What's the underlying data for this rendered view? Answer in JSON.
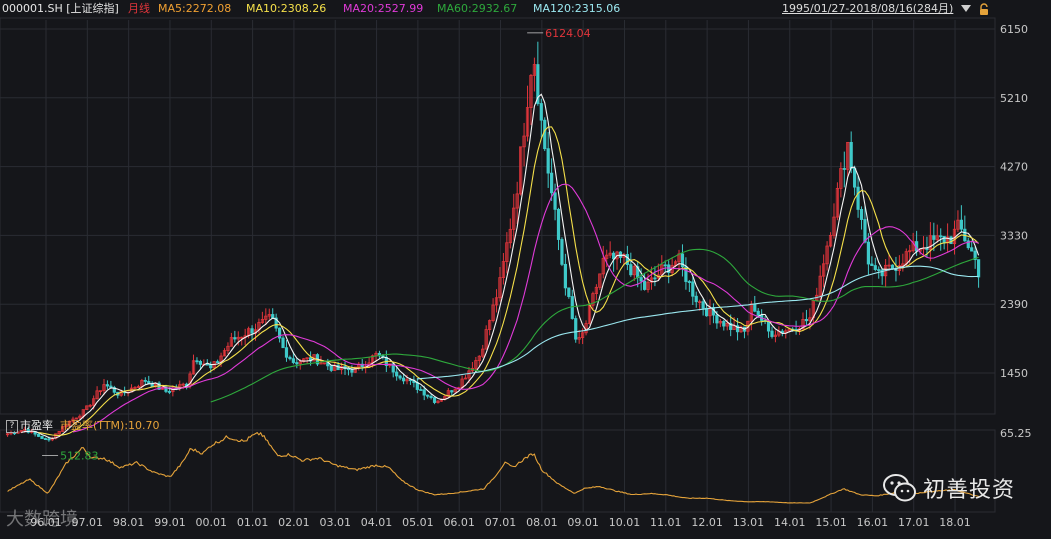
{
  "header": {
    "symbol": "000001.SH [上证综指]",
    "period": "月线",
    "ma5": "MA5:2272.08",
    "ma10": "MA10:2308.26",
    "ma20": "MA20:2527.99",
    "ma60": "MA60:2932.67",
    "ma120": "MA120:2315.06",
    "range": "1995/01/27-2018/08/16(284月)",
    "dropdown_icon": "triangle-down-icon",
    "lock_icon": "lock-icon"
  },
  "subpanel": {
    "help": "?",
    "name": "市盈率",
    "value_label": "市盈率(TTM):10.70"
  },
  "watermark": {
    "brand": "初善投资",
    "wechat_icon": "wechat-icon",
    "source": "大数跨境"
  },
  "colors": {
    "bg": "#15161a",
    "grid": "#2a2c33",
    "up": "#e0353b",
    "down": "#3fc9c9",
    "ma5": "#f5f5f5",
    "ma10": "#f5e04a",
    "ma20": "#e03ad8",
    "ma60": "#2ea83c",
    "ma120": "#9be8f0",
    "pe": "#e5a33a",
    "axis_text": "#c8c8c8"
  },
  "chart_data": [
    {
      "type": "candlestick",
      "title": "000001.SH [上证综指] 月线",
      "y_ticks": [
        1450,
        2390,
        3330,
        4270,
        5210,
        6150
      ],
      "x_ticks": [
        "96.01",
        "97.01",
        "98.01",
        "99.01",
        "00.01",
        "01.01",
        "02.01",
        "03.01",
        "04.01",
        "05.01",
        "06.01",
        "07.01",
        "08.01",
        "09.01",
        "10.01",
        "11.01",
        "12.01",
        "13.01",
        "14.01",
        "15.01",
        "16.01",
        "17.01",
        "18.01"
      ],
      "annotations": [
        {
          "label": "6124.04",
          "date": 2007.79,
          "value": 6124.04
        },
        {
          "label": "512.83",
          "date": 1996.05,
          "value": 512.83
        }
      ],
      "price_anchors": [
        [
          1995.07,
          620
        ],
        [
          1995.5,
          680
        ],
        [
          1996.05,
          520
        ],
        [
          1996.5,
          760
        ],
        [
          1996.95,
          940
        ],
        [
          1997.4,
          1300
        ],
        [
          1997.8,
          1150
        ],
        [
          1998.4,
          1350
        ],
        [
          1998.9,
          1200
        ],
        [
          1999.4,
          1300
        ],
        [
          1999.6,
          1680
        ],
        [
          2000.0,
          1500
        ],
        [
          2000.5,
          1900
        ],
        [
          2001.0,
          2050
        ],
        [
          2001.45,
          2200
        ],
        [
          2001.75,
          1770
        ],
        [
          2002.0,
          1600
        ],
        [
          2002.5,
          1650
        ],
        [
          2003.0,
          1500
        ],
        [
          2003.5,
          1500
        ],
        [
          2004.0,
          1700
        ],
        [
          2004.5,
          1450
        ],
        [
          2005.0,
          1250
        ],
        [
          2005.45,
          1060
        ],
        [
          2006.0,
          1300
        ],
        [
          2006.5,
          1700
        ],
        [
          2007.0,
          2700
        ],
        [
          2007.4,
          4000
        ],
        [
          2007.79,
          5900
        ],
        [
          2008.0,
          4800
        ],
        [
          2008.5,
          2900
        ],
        [
          2008.85,
          1820
        ],
        [
          2009.0,
          1990
        ],
        [
          2009.5,
          3000
        ],
        [
          2010.0,
          3000
        ],
        [
          2010.5,
          2600
        ],
        [
          2010.9,
          2850
        ],
        [
          2011.3,
          3000
        ],
        [
          2011.7,
          2500
        ],
        [
          2012.0,
          2300
        ],
        [
          2012.5,
          2100
        ],
        [
          2012.9,
          2000
        ],
        [
          2013.1,
          2400
        ],
        [
          2013.5,
          2000
        ],
        [
          2014.0,
          2050
        ],
        [
          2014.5,
          2200
        ],
        [
          2014.9,
          3200
        ],
        [
          2015.4,
          4600
        ],
        [
          2015.7,
          3600
        ],
        [
          2015.9,
          3000
        ],
        [
          2016.1,
          2750
        ],
        [
          2016.5,
          2900
        ],
        [
          2017.0,
          3150
        ],
        [
          2017.5,
          3250
        ],
        [
          2017.9,
          3300
        ],
        [
          2018.1,
          3450
        ],
        [
          2018.45,
          3050
        ],
        [
          2018.63,
          2730
        ]
      ],
      "series": [
        {
          "name": "MA5",
          "value": 2272.08
        },
        {
          "name": "MA10",
          "value": 2308.26
        },
        {
          "name": "MA20",
          "value": 2527.99
        },
        {
          "name": "MA60",
          "value": 2932.67
        },
        {
          "name": "MA120",
          "value": 2315.06
        }
      ]
    },
    {
      "type": "line",
      "title": "市盈率",
      "series": [
        {
          "name": "市盈率(TTM)",
          "value": 10.7
        }
      ],
      "y_ticks": [
        65.25
      ],
      "pe_anchors": [
        [
          1995.07,
          16
        ],
        [
          1995.6,
          26
        ],
        [
          1996.05,
          14
        ],
        [
          1996.5,
          40
        ],
        [
          1996.9,
          53
        ],
        [
          1997.1,
          44
        ],
        [
          1997.4,
          44
        ],
        [
          1997.8,
          36
        ],
        [
          1998.2,
          40
        ],
        [
          1998.6,
          32
        ],
        [
          1999.0,
          28
        ],
        [
          1999.3,
          40
        ],
        [
          1999.5,
          52
        ],
        [
          1999.8,
          48
        ],
        [
          2000.0,
          55
        ],
        [
          2000.4,
          62
        ],
        [
          2000.8,
          58
        ],
        [
          2001.0,
          63
        ],
        [
          2001.2,
          65
        ],
        [
          2001.4,
          56
        ],
        [
          2001.6,
          46
        ],
        [
          2001.9,
          47
        ],
        [
          2002.2,
          42
        ],
        [
          2002.6,
          44
        ],
        [
          2003.0,
          38
        ],
        [
          2003.5,
          34
        ],
        [
          2004.0,
          38
        ],
        [
          2004.3,
          36
        ],
        [
          2004.6,
          25
        ],
        [
          2005.0,
          17
        ],
        [
          2005.4,
          13
        ],
        [
          2005.8,
          14
        ],
        [
          2006.2,
          16
        ],
        [
          2006.6,
          18
        ],
        [
          2006.9,
          30
        ],
        [
          2007.1,
          40
        ],
        [
          2007.3,
          36
        ],
        [
          2007.6,
          44
        ],
        [
          2007.8,
          48
        ],
        [
          2008.0,
          34
        ],
        [
          2008.4,
          22
        ],
        [
          2008.8,
          14
        ],
        [
          2009.0,
          18
        ],
        [
          2009.4,
          20
        ],
        [
          2009.8,
          16
        ],
        [
          2010.2,
          13
        ],
        [
          2010.6,
          14
        ],
        [
          2011.0,
          13
        ],
        [
          2011.5,
          10
        ],
        [
          2012.0,
          10
        ],
        [
          2012.5,
          8
        ],
        [
          2013.0,
          7
        ],
        [
          2013.5,
          7
        ],
        [
          2014.0,
          6
        ],
        [
          2014.5,
          6
        ],
        [
          2014.9,
          12
        ],
        [
          2015.3,
          18
        ],
        [
          2015.7,
          13
        ],
        [
          2016.1,
          12
        ],
        [
          2016.6,
          15
        ],
        [
          2017.0,
          14
        ],
        [
          2017.5,
          16
        ],
        [
          2018.0,
          17
        ],
        [
          2018.3,
          14
        ],
        [
          2018.63,
          10.7
        ]
      ]
    }
  ]
}
